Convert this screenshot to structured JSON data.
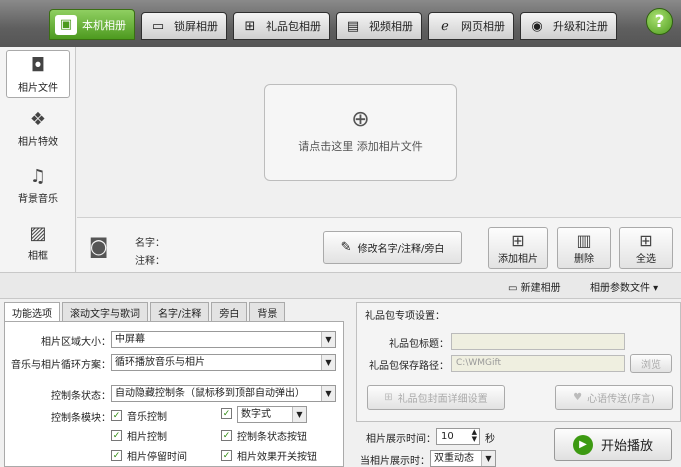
{
  "top_tabs": [
    {
      "label": "本机相册",
      "icon": "local-album-icon"
    },
    {
      "label": "锁屏相册",
      "icon": "monitor-icon"
    },
    {
      "label": "礼品包相册",
      "icon": "gift-icon"
    },
    {
      "label": "视频相册",
      "icon": "film-icon"
    },
    {
      "label": "网页相册",
      "icon": "ie-browser-icon"
    },
    {
      "label": "升级和注册",
      "icon": "globe-icon"
    }
  ],
  "help_label": "?",
  "sidebar": {
    "items": [
      {
        "label": "相片文件",
        "icon": "camera-icon"
      },
      {
        "label": "相片特效",
        "icon": "effects-icon"
      },
      {
        "label": "背景音乐",
        "icon": "music-note-icon"
      },
      {
        "label": "相框",
        "icon": "frame-icon"
      }
    ]
  },
  "drop_area": {
    "text": "请点击这里  添加相片文件",
    "icon": "add-photo-icon"
  },
  "info": {
    "name_label": "名字：",
    "note_label": "注释：",
    "edit_button": "修改名字/注释/旁白",
    "add_button": "添加相片",
    "delete_button": "删除",
    "select_all_button": "全选"
  },
  "strip": {
    "new_album": "新建相册",
    "album_params": "相册参数文件"
  },
  "bottom_tabs": [
    "功能选项",
    "滚动文字与歌词",
    "名字/注释",
    "旁白",
    "背景"
  ],
  "options": {
    "area_size_label": "相片区域大小：",
    "area_size_value": "中屏幕",
    "loop_label": "音乐与相片循环方案：",
    "loop_value": "循环播放音乐与相片",
    "control_state_label": "控制条状态：",
    "control_state_value": "自动隐藏控制条（鼠标移到顶部自动弹出）",
    "control_module_label": "控制条模块：",
    "checkboxes": [
      "音乐控制",
      "相片控制",
      "相片停留时间",
      "控制条状态按钮",
      "相片效果开关按钮"
    ],
    "digital_select": "数字式"
  },
  "gift": {
    "title": "礼品包专项设置：",
    "title_label": "礼品包标题：",
    "path_label": "礼品包保存路径：",
    "path_value": "C:\\WMGift",
    "browse_button": "浏览",
    "cover_button": "礼品包封面详细设置",
    "greeting_button": "心语传送(序言)"
  },
  "playback": {
    "show_time_label": "相片展示时间：",
    "show_time_value": "10",
    "seconds": "秒",
    "show_mode_label": "当相片展示时：",
    "show_mode_value": "双重动态",
    "start_button": "开始播放"
  }
}
